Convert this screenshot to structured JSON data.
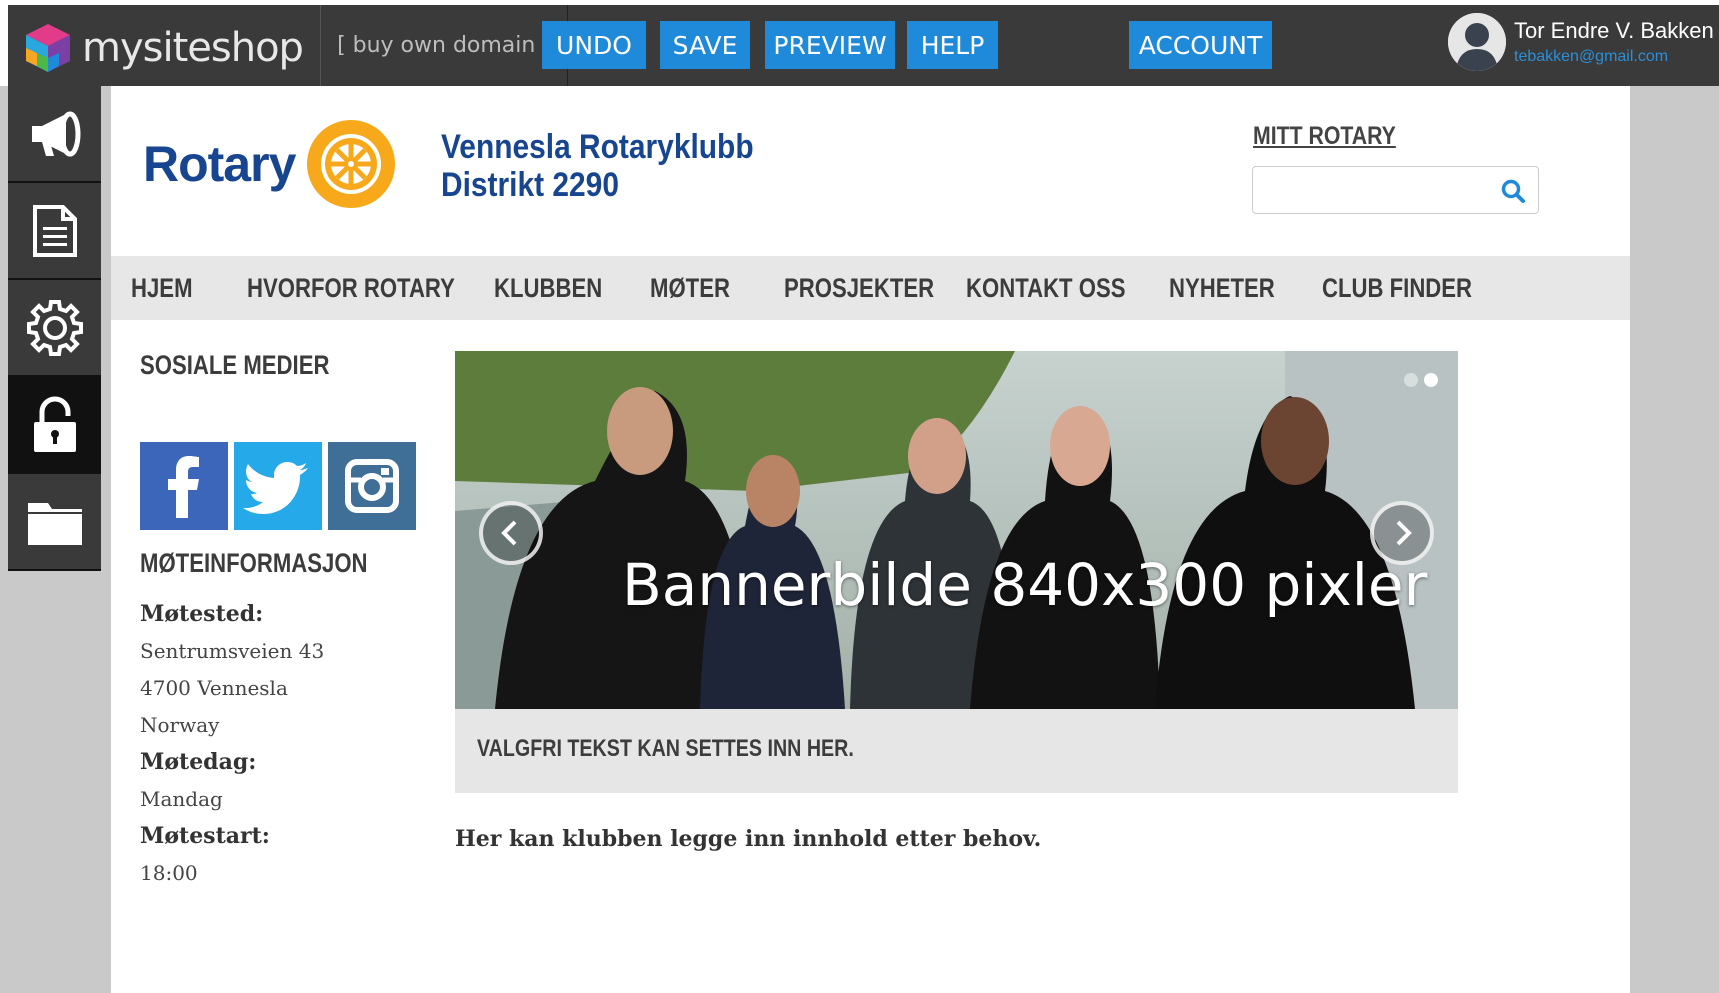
{
  "editor": {
    "brand": "mysiteshop",
    "buy_domain": "[ buy own domain ]",
    "buttons": {
      "undo": "UNDO",
      "save": "SAVE",
      "preview": "PREVIEW",
      "help": "HELP",
      "account": "ACCOUNT"
    },
    "user": {
      "name": "Tor Endre V. Bakken",
      "email": "tebakken@gmail.com"
    },
    "sidebar": [
      {
        "icon": "megaphone-icon",
        "active": false
      },
      {
        "icon": "document-icon",
        "active": false
      },
      {
        "icon": "gear-icon",
        "active": false
      },
      {
        "icon": "lock-icon",
        "active": true
      },
      {
        "icon": "folder-icon",
        "active": false
      }
    ],
    "accent_color": "#1f8ad9"
  },
  "site": {
    "logo_word": "Rotary",
    "club_name_line1": "Vennesla Rotaryklubb",
    "club_name_line2": "Distrikt 2290",
    "mitt_rotary": "MITT ROTARY",
    "search": {
      "value": "",
      "placeholder": ""
    },
    "nav": [
      "HJEM",
      "HVORFOR ROTARY",
      "KLUBBEN",
      "MØTER",
      "PROSJEKTER",
      "KONTAKT OSS",
      "NYHETER",
      "CLUB FINDER"
    ],
    "social_title": "SOSIALE MEDIER",
    "social": [
      "facebook-icon",
      "twitter-icon",
      "instagram-icon"
    ],
    "meeting_title": "MØTEINFORMASJON",
    "meeting": {
      "place_label": "Møtested:",
      "address1": "Sentrumsveien 43",
      "address2": "4700 Vennesla",
      "country": "Norway",
      "day_label": "Møtedag:",
      "day": "Mandag",
      "start_label": "Møtestart:",
      "start": "18:00"
    },
    "banner_caption": "Bannerbilde 840x300 pixler",
    "banner_slides": 2,
    "banner_active_slide": 2,
    "optional_text": "VALGFRI TEKST KAN SETTES INN HER.",
    "body_text": "Her kan klubben legge inn innhold etter behov.",
    "brand_blue": "#17458f",
    "rotary_gold": "#f7a81b"
  }
}
